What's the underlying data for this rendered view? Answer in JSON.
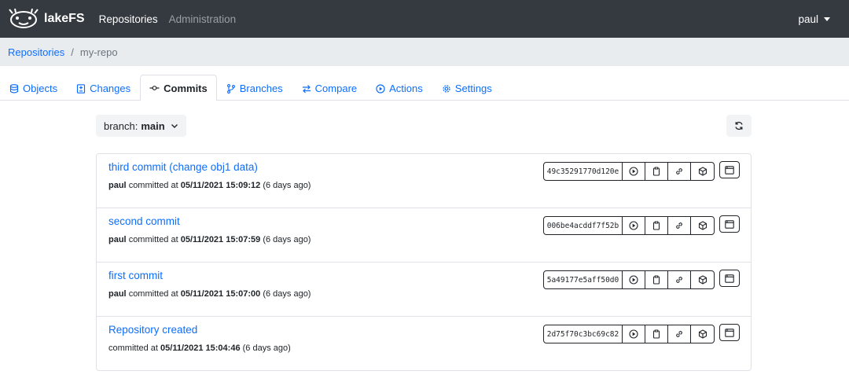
{
  "navbar": {
    "brand": "lakeFS",
    "links": [
      "Repositories",
      "Administration"
    ],
    "user": "paul"
  },
  "breadcrumb": {
    "root": "Repositories",
    "current": "my-repo"
  },
  "tabs": [
    {
      "label": "Objects",
      "icon": "database-icon"
    },
    {
      "label": "Changes",
      "icon": "file-diff-icon"
    },
    {
      "label": "Commits",
      "icon": "git-commit-icon",
      "active": true
    },
    {
      "label": "Branches",
      "icon": "git-branch-icon"
    },
    {
      "label": "Compare",
      "icon": "compare-arrows-icon"
    },
    {
      "label": "Actions",
      "icon": "play-circle-icon"
    },
    {
      "label": "Settings",
      "icon": "gear-icon"
    }
  ],
  "branch_selector": {
    "prefix": "branch:",
    "value": "main"
  },
  "commits": [
    {
      "title": "third commit (change obj1 data)",
      "committer": "paul",
      "at_label": "committed at",
      "timestamp": "05/11/2021 15:09:12",
      "relative": "(6 days ago)",
      "sha": "49c35291770d120e"
    },
    {
      "title": "second commit",
      "committer": "paul",
      "at_label": "committed at",
      "timestamp": "05/11/2021 15:07:59",
      "relative": "(6 days ago)",
      "sha": "006be4acddf7f52b"
    },
    {
      "title": "first commit",
      "committer": "paul",
      "at_label": "committed at",
      "timestamp": "05/11/2021 15:07:00",
      "relative": "(6 days ago)",
      "sha": "5a49177e5aff50d0"
    },
    {
      "title": "Repository created",
      "committer": "",
      "at_label": "committed at",
      "timestamp": "05/11/2021 15:04:46",
      "relative": "(6 days ago)",
      "sha": "2d75f70c3bc69c82"
    }
  ],
  "colors": {
    "navbar_bg": "#343a40",
    "link": "#0d6efd",
    "breadcrumb_bg": "#e9ecef"
  }
}
